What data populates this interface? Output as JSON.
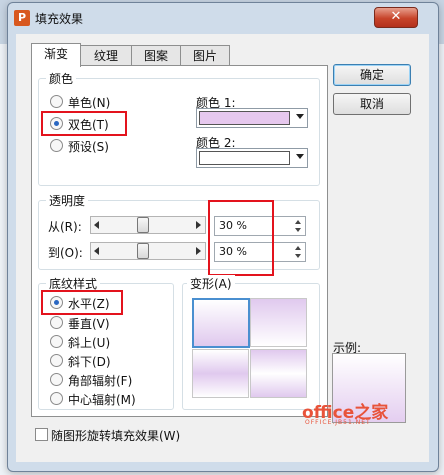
{
  "dialog": {
    "icon_letter": "P",
    "title": "填充效果",
    "close_glyph": "✕"
  },
  "tabs": [
    "渐变",
    "纹理",
    "图案",
    "图片"
  ],
  "colors_group": {
    "label": "颜色",
    "options": [
      "单色(N)",
      "双色(T)",
      "预设(S)"
    ],
    "selected_index": 1,
    "color1_label": "颜色 1:",
    "color2_label": "颜色 2:",
    "color1": "#e6c8ee",
    "color2": "#ffffff"
  },
  "transparency": {
    "label": "透明度",
    "from_label": "从(R):",
    "to_label": "到(O):",
    "from_value": "30 %",
    "to_value": "30 %",
    "from_level": 0.3,
    "to_level": 0.3
  },
  "shading": {
    "label": "底纹样式",
    "options": [
      "水平(Z)",
      "垂直(V)",
      "斜上(U)",
      "斜下(D)",
      "角部辐射(F)",
      "中心辐射(M)"
    ],
    "selected_index": 0
  },
  "variants_label": "变形(A)",
  "buttons": {
    "ok": "确定",
    "cancel": "取消"
  },
  "sample_label": "示例:",
  "rotate_checkbox": "随图形旋转填充效果(W)",
  "watermark": {
    "main": "office之家",
    "sub": "OFFICE.JB51.NET"
  },
  "accent": {
    "highlight": "#e3131d",
    "fill": "#e6c8ee"
  }
}
